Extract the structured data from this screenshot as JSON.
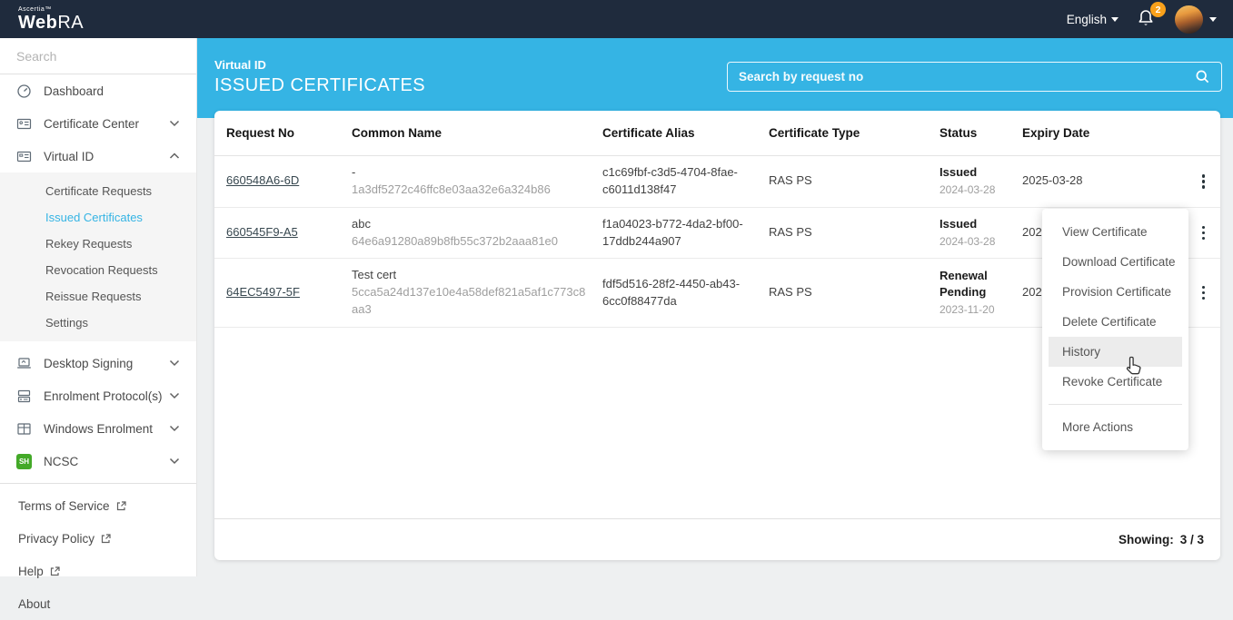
{
  "topbar": {
    "brand_small": "Ascertia™",
    "brand_web": "Web",
    "brand_ra": "RA",
    "language": "English",
    "notification_count": "2"
  },
  "sidebar": {
    "search_placeholder": "Search",
    "items": [
      {
        "label": "Dashboard"
      },
      {
        "label": "Certificate Center"
      },
      {
        "label": "Virtual ID"
      },
      {
        "label": "Desktop Signing"
      },
      {
        "label": "Enrolment Protocol(s)"
      },
      {
        "label": "Windows Enrolment"
      },
      {
        "label": "NCSC"
      }
    ],
    "ncsc_icon_text": "SH",
    "virtual_id_children": [
      {
        "label": "Certificate Requests"
      },
      {
        "label": "Issued Certificates",
        "active": true
      },
      {
        "label": "Rekey Requests"
      },
      {
        "label": "Revocation Requests"
      },
      {
        "label": "Reissue Requests"
      },
      {
        "label": "Settings"
      }
    ],
    "footer_links": [
      {
        "label": "Terms of Service",
        "external": true
      },
      {
        "label": "Privacy Policy",
        "external": true
      },
      {
        "label": "Help",
        "external": true
      },
      {
        "label": "About",
        "external": false
      }
    ]
  },
  "header": {
    "breadcrumb": "Virtual ID",
    "title": "ISSUED CERTIFICATES",
    "search_placeholder": "Search by request no"
  },
  "table": {
    "columns": [
      "Request No",
      "Common Name",
      "Certificate Alias",
      "Certificate Type",
      "Status",
      "Expiry Date"
    ],
    "rows": [
      {
        "request_no": "660548A6-6D",
        "common_name": "-",
        "common_name_sub": "1a3df5272c46ffc8e03aa32e6a324b86",
        "alias": "c1c69fbf-c3d5-4704-8fae-c6011d138f47",
        "type": "RAS PS",
        "status": "Issued",
        "status_date": "2024-03-28",
        "expiry": "2025-03-28"
      },
      {
        "request_no": "660545F9-A5",
        "common_name": "abc",
        "common_name_sub": "64e6a91280a89b8fb55c372b2aaa81e0",
        "alias": "f1a04023-b772-4da2-bf00-17ddb244a907",
        "type": "RAS PS",
        "status": "Issued",
        "status_date": "2024-03-28",
        "expiry": "202"
      },
      {
        "request_no": "64EC5497-5F",
        "common_name": "Test cert",
        "common_name_sub": "5cca5a24d137e10e4a58def821a5af1c773c8aa3",
        "alias": "fdf5d516-28f2-4450-ab43-6cc0f88477da",
        "type": "RAS PS",
        "status": "Renewal Pending",
        "status_date": "2023-11-20",
        "expiry": "202"
      }
    ],
    "showing_label": "Showing:",
    "showing_value": "3 / 3"
  },
  "context_menu": {
    "items": [
      "View Certificate",
      "Download Certificate",
      "Provision Certificate",
      "Delete Certificate",
      "History",
      "Revoke Certificate"
    ],
    "highlighted": "History",
    "footer_item": "More Actions"
  },
  "colors": {
    "accent_blue": "#35b4e4",
    "topbar_bg": "#1f2b3d",
    "badge_orange": "#f9a11b",
    "ncsc_green": "#43a928"
  }
}
